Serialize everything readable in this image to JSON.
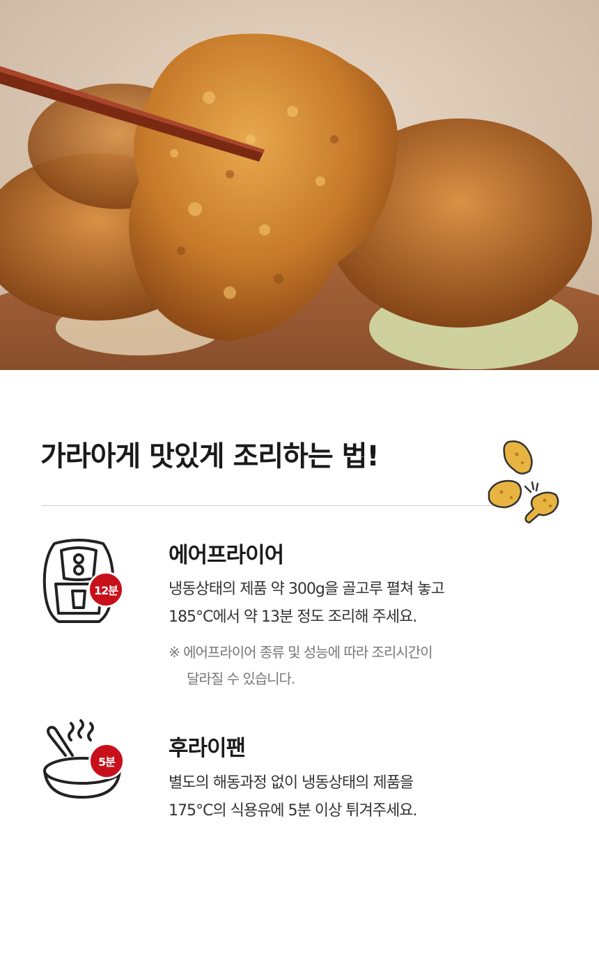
{
  "hero": {
    "image_alt": "fried chicken held with chopsticks",
    "icon": "fried-chicken-photo"
  },
  "title": {
    "text": "가라아게 맛있게 조리하는 법!"
  },
  "methods": [
    {
      "name": "에어프라이어",
      "icon": "air-fryer-icon",
      "badge": "12분",
      "desc_lines": [
        "냉동상태의 제품 약 300g을 골고루 펼쳐 놓고",
        "185°C에서 약 13분 정도 조리해 주세요."
      ],
      "note_lines": [
        "※ 에어프라이어 종류 및 성능에 따라 조리시간이",
        "달라질 수 있습니다."
      ]
    },
    {
      "name": "후라이팬",
      "icon": "frying-pan-icon",
      "badge": "5분",
      "desc_lines": [
        "별도의 해동과정 없이 냉동상태의 제품을",
        "175°C의 식용유에 5분 이상 튀겨주세요."
      ]
    }
  ],
  "colors": {
    "accent": "#c8101b",
    "divider": "#cfcfcf",
    "chicken": "#e8b441"
  }
}
